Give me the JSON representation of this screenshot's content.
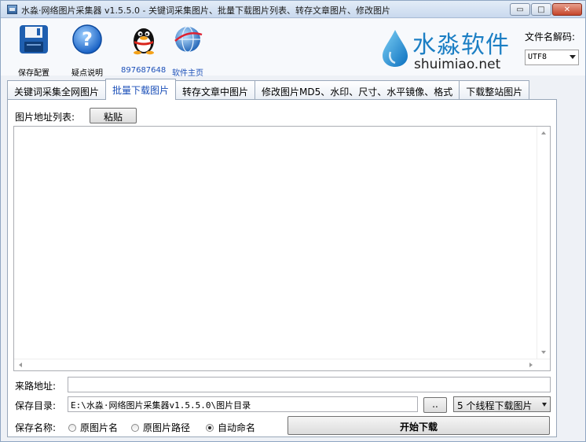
{
  "window": {
    "title": "水淼·网络图片采集器 v1.5.5.0 - 关键词采集图片、批量下载图片列表、转存文章图片、修改图片",
    "minimize": "▭",
    "maximize": "□",
    "close": "✕"
  },
  "toolbar": {
    "save_config": "保存配置",
    "help": "疑点说明",
    "qq": "897687648",
    "homepage": "软件主页"
  },
  "brand": {
    "name_cn": "水淼软件",
    "name_en": "shuimiao.net"
  },
  "encoding": {
    "label": "文件名解码:",
    "value": "UTF8"
  },
  "tabs": [
    {
      "label": "关键词采集全网图片"
    },
    {
      "label": "批量下载图片"
    },
    {
      "label": "转存文章中图片"
    },
    {
      "label": "修改图片MD5、水印、尺寸、水平镜像、格式"
    },
    {
      "label": "下载整站图片"
    }
  ],
  "list": {
    "label": "图片地址列表:",
    "paste_button": "粘贴"
  },
  "referer": {
    "label": "来路地址:",
    "value": ""
  },
  "save_dir": {
    "label": "保存目录:",
    "value": "E:\\水淼·网络图片采集器v1.5.5.0\\图片目录",
    "browse_button": "..",
    "threads": "5 个线程下载图片"
  },
  "save_name": {
    "label": "保存名称:",
    "options": [
      "原图片名",
      "原图片路径",
      "自动命名"
    ],
    "selected": 2
  },
  "start_button": "开始下载",
  "colors": {
    "accent": "#1b4fb8",
    "brand": "#1c7fc4"
  }
}
